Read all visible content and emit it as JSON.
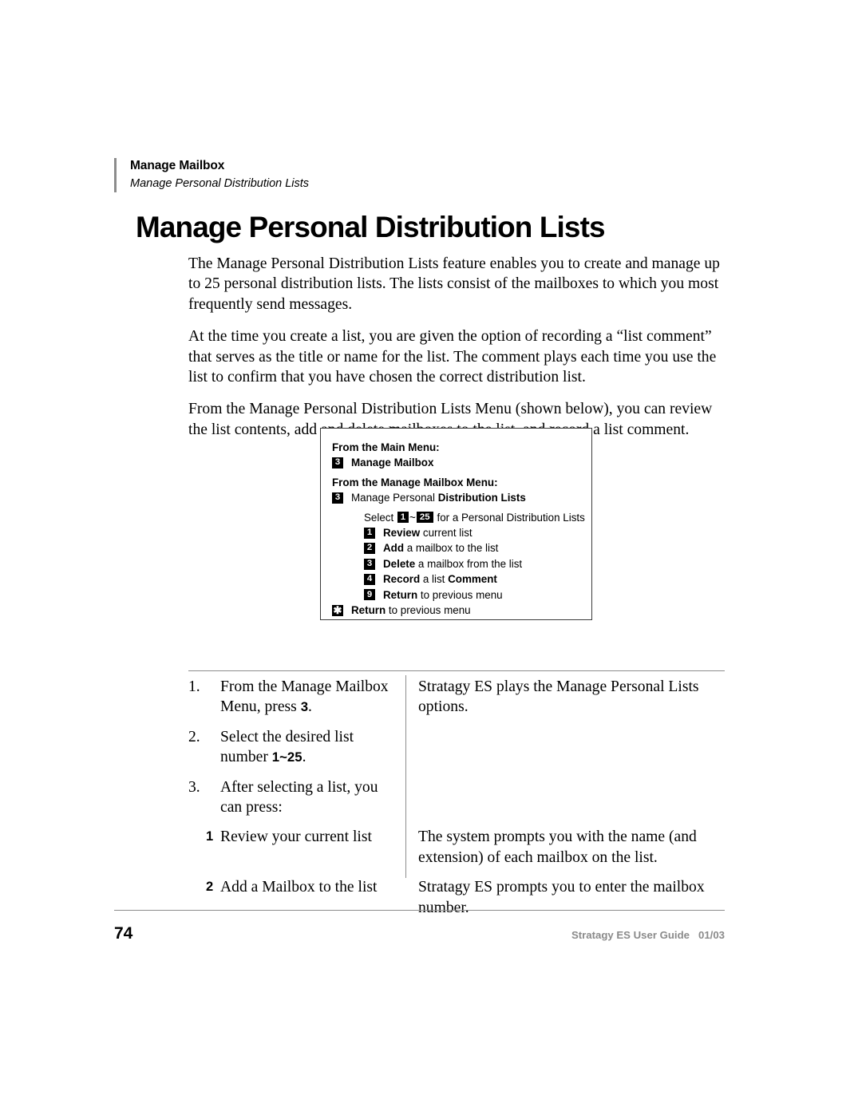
{
  "header": {
    "chapter": "Manage Mailbox",
    "section": "Manage Personal Distribution Lists"
  },
  "title": "Manage Personal Distribution Lists",
  "paragraphs": [
    "The Manage Personal Distribution Lists feature enables you to create and manage up to 25 personal distribution lists. The lists consist of the mailboxes to which you most frequently send messages.",
    "At the time you create a list, you are given the option of recording a “list comment” that serves as the title or name for the list. The comment plays each time you use the list to confirm that you have chosen the correct distribution list.",
    "From the Manage Personal Distribution Lists Menu (shown below), you can review the list contents, add and delete mailboxes to the list, and record a list comment."
  ],
  "menu_box": {
    "heading_1": "From the Main Menu:",
    "item_1": {
      "key": "3",
      "label": "Manage Mailbox"
    },
    "heading_2": "From the Manage Mailbox Menu:",
    "item_2": {
      "key": "3",
      "label_plain": "Manage Personal ",
      "label_bold": "Distribution Lists"
    },
    "select_line": {
      "prefix": "Select ",
      "key_from": "1",
      "separator": "~",
      "key_to": "25",
      "suffix": " for a Personal Distribution Lists"
    },
    "options": [
      {
        "key": "1",
        "bold": "Review",
        "rest": " current list"
      },
      {
        "key": "2",
        "bold": "Add",
        "rest": " a mailbox to the list"
      },
      {
        "key": "3",
        "bold": "Delete",
        "rest": " a mailbox from the list"
      },
      {
        "key": "4",
        "bold": "Record",
        "rest": " a list ",
        "bold2": "Comment"
      },
      {
        "key": "9",
        "bold": "Return",
        "rest": " to previous menu"
      }
    ],
    "return_item": {
      "key": "✱",
      "bold": "Return",
      "rest": " to previous menu"
    }
  },
  "steps": [
    {
      "number": "1.",
      "left_pre": "From the Manage Mailbox Menu, press ",
      "left_key": "3",
      "left_post": ".",
      "right": "Stratagy ES plays the Manage Personal Lists options."
    },
    {
      "number": "2.",
      "left_pre": "Select the desired list number ",
      "left_key": "1~25",
      "left_post": ".",
      "right": ""
    },
    {
      "number": "3.",
      "left_pre": "After selecting a list, you can press:",
      "left_key": "",
      "left_post": "",
      "right": ""
    }
  ],
  "substeps": [
    {
      "key": "1",
      "left": "Review your current list",
      "right": "The system prompts you with the name (and extension) of each mailbox on the list."
    },
    {
      "key": "2",
      "left": "Add a Mailbox to the list",
      "right": "Stratagy ES prompts you to enter the mailbox number."
    }
  ],
  "footer": {
    "page_number": "74",
    "guide": "Stratagy ES User Guide",
    "date": "01/03"
  }
}
